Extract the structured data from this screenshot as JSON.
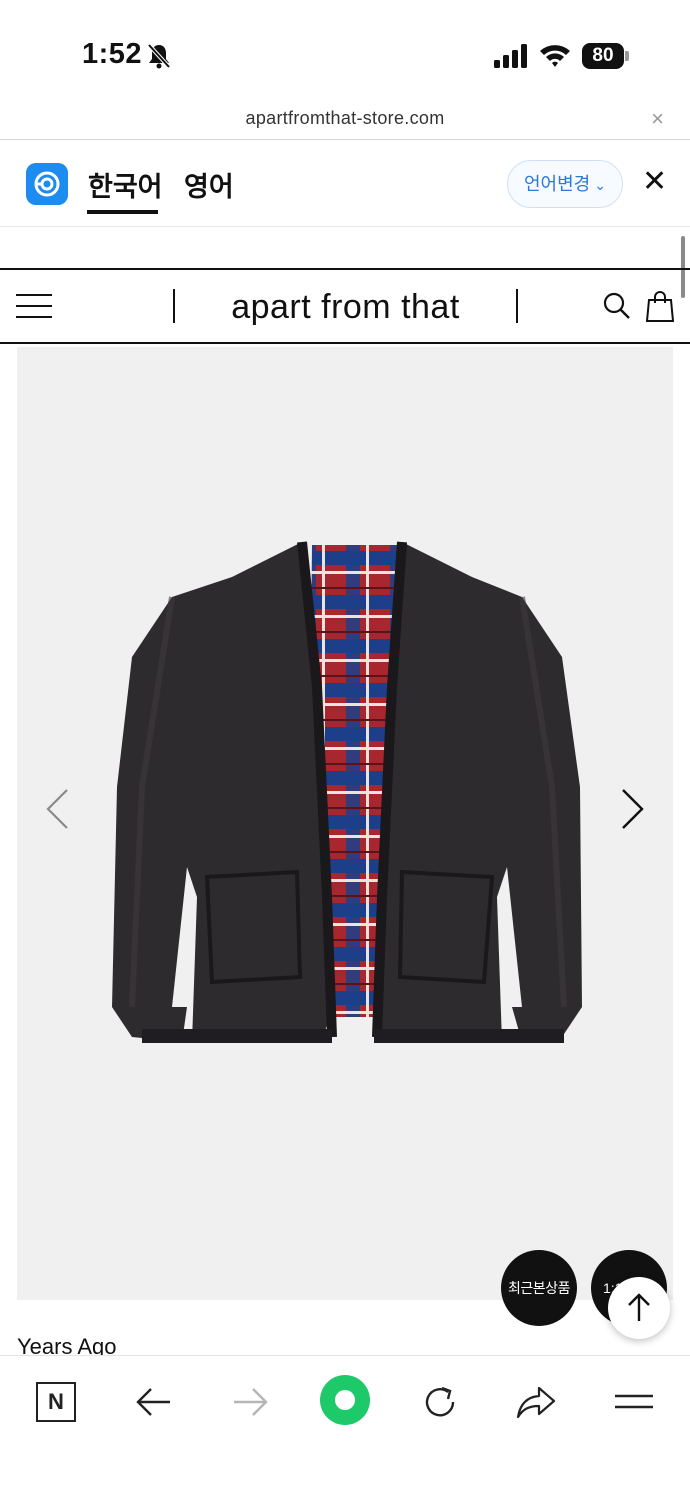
{
  "status_bar": {
    "time": "1:52",
    "battery": "80"
  },
  "browser": {
    "url": "apartfromthat-store.com",
    "close_symbol": "×"
  },
  "translate_bar": {
    "source_language": "한국어",
    "target_language": "영어",
    "change_language_label": "언어변경",
    "close_symbol": "✕"
  },
  "site": {
    "title": "apart from that"
  },
  "product": {
    "brand_text": "Years Ago",
    "image_background": "#f0f0f0"
  },
  "floating_buttons": {
    "recent_label": "최근본상품",
    "chat_label": "1:1"
  },
  "toolbar": {
    "n_label": "N",
    "home_color": "#1ec96a"
  },
  "colors": {
    "accent_blue": "#2a7ad8",
    "translate_logo": "#1d8cf0"
  }
}
